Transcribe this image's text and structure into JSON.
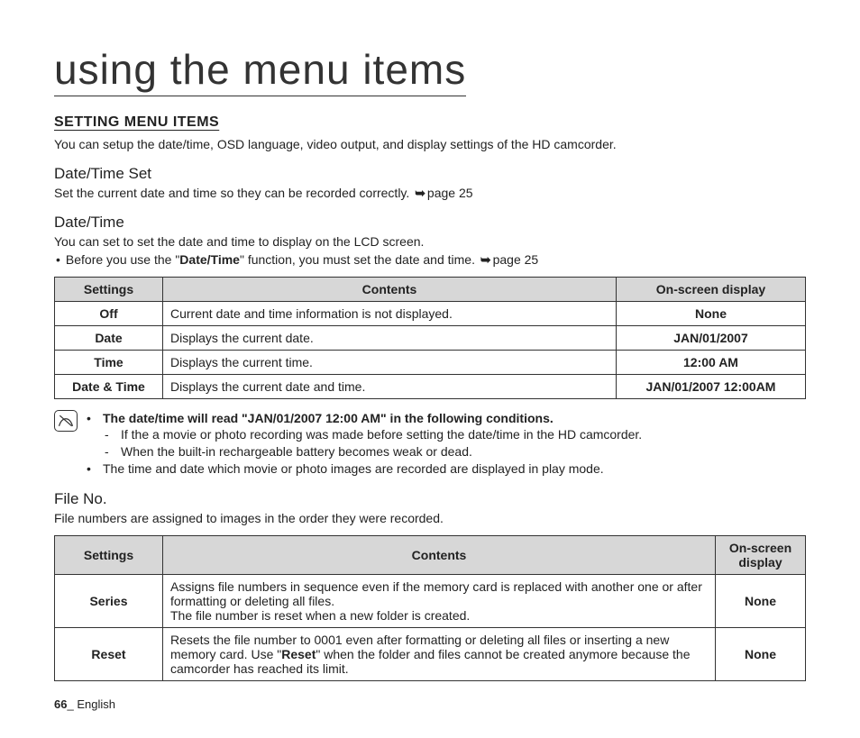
{
  "pageTitle": "using the menu items",
  "sectionHeading": "SETTING MENU ITEMS",
  "introPara": "You can setup the date/time, OSD language, video output, and display settings of the HD camcorder.",
  "dateTimeSet": {
    "heading": "Date/Time Set",
    "text": "Set the current date and time so they can be recorded correctly. ",
    "pageRef": "page 25"
  },
  "dateTime": {
    "heading": "Date/Time",
    "line1": "You can set to set the date and time to display on the LCD screen.",
    "bulletPrefix": "Before you use the \"",
    "bulletBold": "Date/Time",
    "bulletSuffix": "\" function, you must set the date and time. ",
    "pageRef": "page 25"
  },
  "table1": {
    "headers": [
      "Settings",
      "Contents",
      "On-screen display"
    ],
    "rows": [
      {
        "s": "Off",
        "c": "Current date and time information is not displayed.",
        "o": "None"
      },
      {
        "s": "Date",
        "c": "Displays the current date.",
        "o": "JAN/01/2007"
      },
      {
        "s": "Time",
        "c": "Displays the current time.",
        "o": "12:00 AM"
      },
      {
        "s": "Date & Time",
        "c": "Displays the current date and time.",
        "o": "JAN/01/2007 12:00AM"
      }
    ]
  },
  "note": {
    "b1": "The date/time will read \"JAN/01/2007 12:00 AM\" in the following conditions.",
    "s1": "If the a movie or photo recording was made before setting the date/time in the HD camcorder.",
    "s2": "When the built-in rechargeable battery becomes weak or dead.",
    "b2": "The time and date which movie or photo images are recorded are displayed in play mode."
  },
  "fileNo": {
    "heading": "File No.",
    "text": "File numbers are assigned to images in the order they were recorded."
  },
  "table2": {
    "headers": [
      "Settings",
      "Contents",
      "On-screen display"
    ],
    "rows": [
      {
        "s": "Series",
        "c1": "Assigns file numbers in sequence even if the memory card is replaced with another one or after formatting or deleting all files.",
        "c2": "The file number is reset when a new folder is created.",
        "o": "None"
      },
      {
        "s": "Reset",
        "cPrefix": "Resets the file number to 0001 even after formatting or deleting all files or inserting a new memory card. Use \"",
        "cBold": "Reset",
        "cSuffix": "\" when the folder and files cannot be created anymore because the camcorder has reached its limit.",
        "o": "None"
      }
    ]
  },
  "footer": {
    "pageNum": "66",
    "sep": "_ ",
    "lang": "English"
  }
}
